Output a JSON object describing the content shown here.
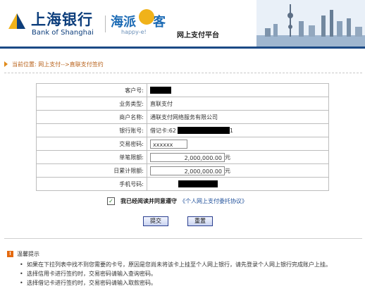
{
  "header": {
    "logo_cn": "上海银行",
    "logo_en": "Bank of Shanghai",
    "brand": "海派",
    "brand_suffix": "客",
    "brand_sub": "happy-e!",
    "platform": "网上支付平台"
  },
  "breadcrumb": "当前位置: 网上支付-->直联支付签约",
  "form": {
    "rows": [
      {
        "label": "客户号:",
        "value": ""
      },
      {
        "label": "业务类型:",
        "value": "直联支付"
      },
      {
        "label": "商户名称:",
        "value": "通联支付网络服务有限公司"
      },
      {
        "label": "银行账号:",
        "value": "借记卡:62",
        "value_suffix": "1"
      },
      {
        "label": "交易密码:",
        "value": "xxxxxx"
      },
      {
        "label": "单笔限额:",
        "value": "2,000,000.00",
        "unit": "元"
      },
      {
        "label": "日累计限额:",
        "value": "2,000,000.00",
        "unit": "元"
      },
      {
        "label": "手机号码:",
        "value": ""
      }
    ]
  },
  "agreement": {
    "checkbox_mark": "✓",
    "text": "我已经阅读并同意遵守",
    "link": "《个人网上支付委托协议》",
    "checked": true
  },
  "buttons": {
    "submit": "提交",
    "reset": "重置"
  },
  "tips": {
    "title": "温馨提示",
    "icon": "!",
    "items": [
      "如果在下拉列表中找不到您需要的卡号，原因是您尚未将该卡上挂至个人网上银行，请先登录个人网上银行完成账户上挂。",
      "选择信用卡进行签约时，交易密码请输入查询密码。",
      "选择借记卡进行签约时，交易密码请输入取款密码。"
    ]
  },
  "colors": {
    "brand_blue": "#0d3e7c",
    "accent_orange": "#e08a1b",
    "link_blue": "#1e4f9a"
  }
}
